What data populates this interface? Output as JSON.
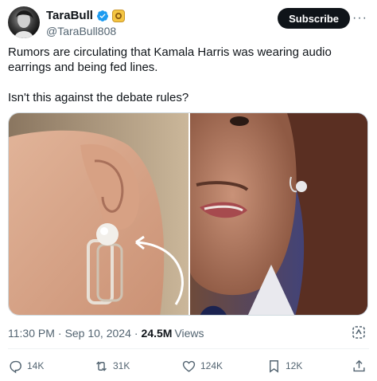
{
  "author": {
    "display_name": "TaraBull",
    "handle": "@TaraBull808"
  },
  "header": {
    "subscribe_label": "Subscribe",
    "more_label": "···"
  },
  "tweet": {
    "text": "Rumors are circulating that Kamala Harris was wearing audio earrings and being fed lines.\n\nIsn't this against the debate rules?"
  },
  "meta": {
    "time": "11:30 PM",
    "date": "Sep 10, 2024",
    "views_count": "24.5M",
    "views_label": "Views",
    "separator": "·"
  },
  "actions": {
    "replies": "14K",
    "reposts": "31K",
    "likes": "124K",
    "bookmarks": "12K"
  },
  "colors": {
    "verified": "#1d9bf0",
    "text_primary": "#0f1419",
    "text_secondary": "#536471"
  }
}
